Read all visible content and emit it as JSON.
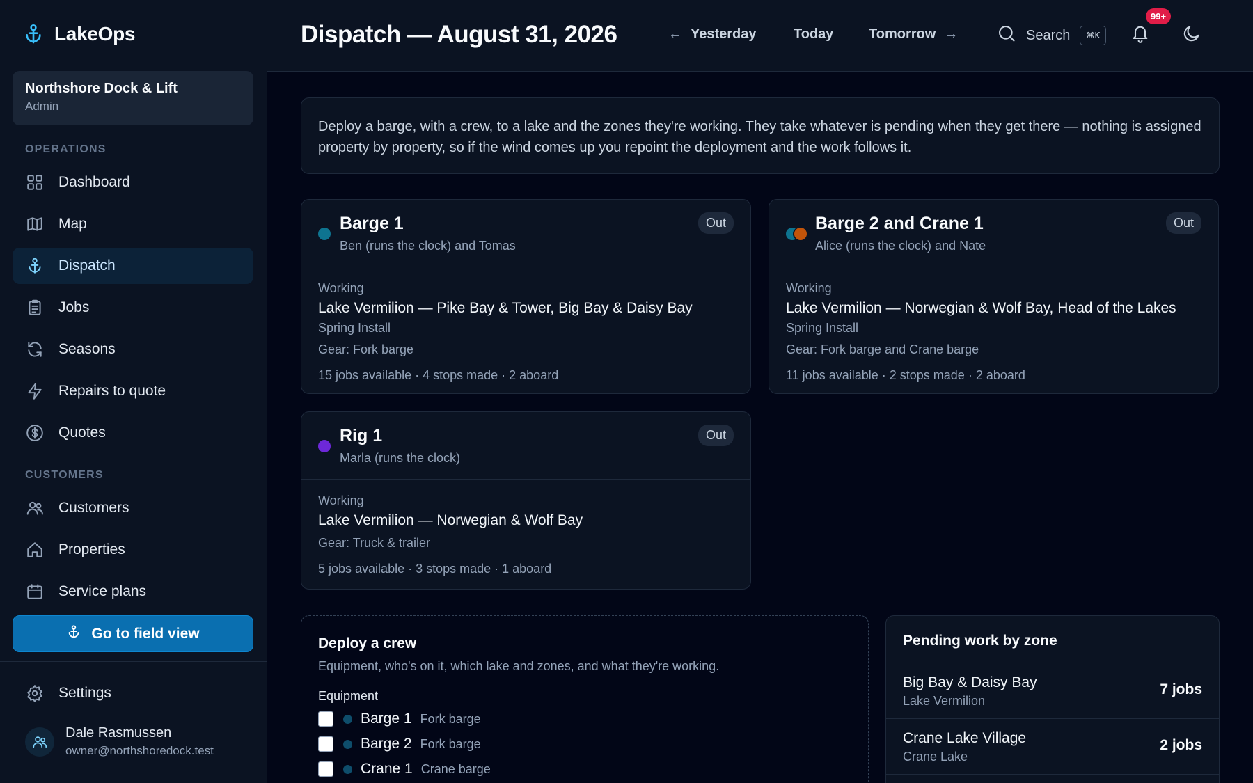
{
  "app": {
    "name": "LakeOps"
  },
  "org": {
    "name": "Northshore Dock & Lift",
    "role": "Admin"
  },
  "sidebar": {
    "sections": [
      {
        "label": "OPERATIONS"
      },
      {
        "label": "CUSTOMERS"
      }
    ],
    "items": [
      {
        "label": "Dashboard",
        "icon": "grid-icon"
      },
      {
        "label": "Map",
        "icon": "map-icon"
      },
      {
        "label": "Dispatch",
        "icon": "anchor-icon",
        "active": true
      },
      {
        "label": "Jobs",
        "icon": "clipboard-icon"
      },
      {
        "label": "Seasons",
        "icon": "refresh-icon"
      },
      {
        "label": "Repairs to quote",
        "icon": "bolt-icon"
      },
      {
        "label": "Quotes",
        "icon": "dollar-icon"
      },
      {
        "label": "Customers",
        "icon": "users-icon"
      },
      {
        "label": "Properties",
        "icon": "home-icon"
      },
      {
        "label": "Service plans",
        "icon": "calendar-icon"
      }
    ],
    "field_view_label": "Go to field view",
    "settings_label": "Settings",
    "user": {
      "name": "Dale Rasmussen",
      "email": "owner@northshoredock.test"
    }
  },
  "header": {
    "title": "Dispatch — August 31, 2026",
    "prev_day": "Yesterday",
    "today": "Today",
    "next_day": "Tomorrow",
    "prev_arrow": "←",
    "next_arrow": "→",
    "search_label": "Search",
    "search_shortcut": "⌘K",
    "notification_count": "99+"
  },
  "intro": "Deploy a barge, with a crew, to a lake and the zones they're working. They take whatever is pending when they get there — nothing is assigned property by property, so if the wind comes up you repoint the deployment and the work follows it.",
  "crews": [
    {
      "name": "Barge 1",
      "members": "Ben (runs the clock) and Tomas",
      "status": "Out",
      "working_label": "Working",
      "location": "Lake Vermilion — Pike Bay & Tower, Big Bay & Daisy Bay",
      "season": "Spring Install",
      "gear": "Gear: Fork barge",
      "stats": "15 jobs available · 4 stops made · 2 aboard",
      "colors": [
        "#0e7490"
      ]
    },
    {
      "name": "Barge 2 and Crane 1",
      "members": "Alice (runs the clock) and Nate",
      "status": "Out",
      "working_label": "Working",
      "location": "Lake Vermilion — Norwegian & Wolf Bay, Head of the Lakes",
      "season": "Spring Install",
      "gear": "Gear: Fork barge and Crane barge",
      "stats": "11 jobs available · 2 stops made · 2 aboard",
      "colors": [
        "#0e7490",
        "#c2540a"
      ]
    },
    {
      "name": "Rig 1",
      "members": "Marla (runs the clock)",
      "status": "Out",
      "working_label": "Working",
      "location": "Lake Vermilion — Norwegian & Wolf Bay",
      "gear": "Gear: Truck & trailer",
      "stats": "5 jobs available · 3 stops made · 1 aboard",
      "colors": [
        "#6d28d9"
      ]
    }
  ],
  "deploy": {
    "title": "Deploy a crew",
    "description": "Equipment, who's on it, which lake and zones, and what they're working.",
    "equipment_label": "Equipment",
    "equipment": [
      {
        "name": "Barge 1",
        "type": "Fork barge"
      },
      {
        "name": "Barge 2",
        "type": "Fork barge"
      },
      {
        "name": "Crane 1",
        "type": "Crane barge"
      }
    ]
  },
  "pending": {
    "title": "Pending work by zone",
    "zones": [
      {
        "name": "Big Bay & Daisy Bay",
        "lake": "Lake Vermilion",
        "count": "7 jobs"
      },
      {
        "name": "Crane Lake Village",
        "lake": "Crane Lake",
        "count": "2 jobs"
      }
    ]
  }
}
